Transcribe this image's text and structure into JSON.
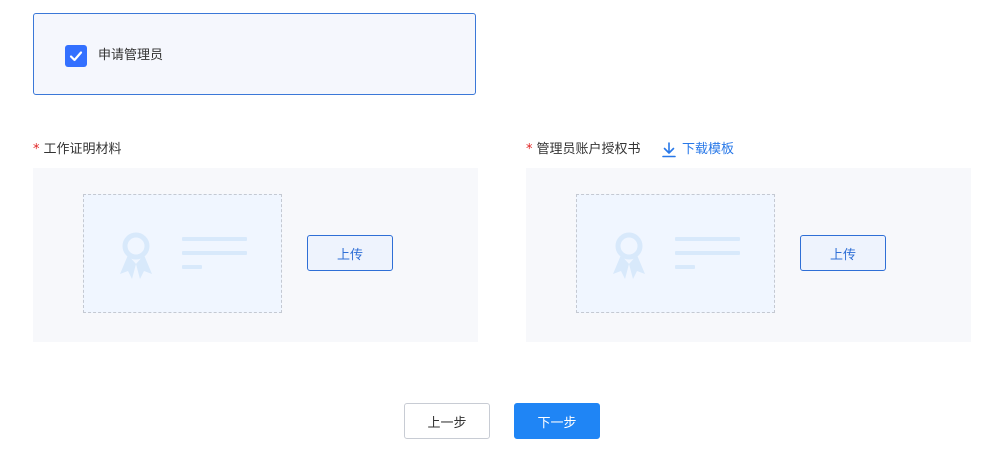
{
  "admin": {
    "checkbox_checked": true,
    "checkbox_label": "申请管理员"
  },
  "work_proof": {
    "required_mark": "*",
    "label": "工作证明材料",
    "upload_label": "上传"
  },
  "authorization": {
    "required_mark": "*",
    "label": "管理员账户授权书",
    "download_label": "下载模板",
    "upload_label": "上传"
  },
  "footer": {
    "prev_label": "上一步",
    "next_label": "下一步"
  },
  "colors": {
    "accent": "#3370ff",
    "primary_button": "#1f85f5",
    "link": "#2878e8",
    "required": "#e02020"
  },
  "icons": {
    "checkbox": "check-icon",
    "download": "download-icon",
    "placeholder": "certificate-icon"
  }
}
